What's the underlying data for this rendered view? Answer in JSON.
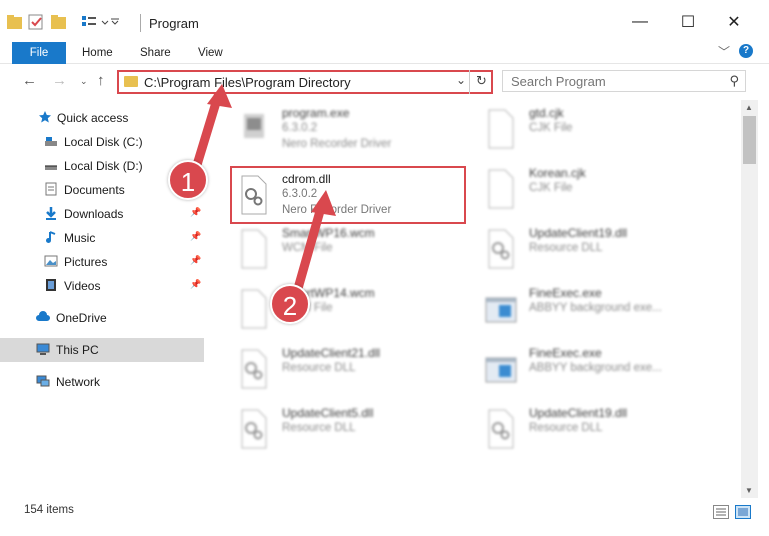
{
  "window": {
    "title": "Program",
    "minimize": "—",
    "maximize": "☐",
    "close": "✕"
  },
  "ribbon": {
    "tabs": [
      "File",
      "Home",
      "Share",
      "View"
    ],
    "help": "?"
  },
  "address": {
    "path": "C:\\Program Files\\Program Directory",
    "search_placeholder": "Search Program"
  },
  "sidebar": {
    "quick_access": "Quick access",
    "items": [
      {
        "label": "Local Disk (C:)",
        "icon": "drive-icon"
      },
      {
        "label": "Local Disk (D:)",
        "icon": "drive-icon"
      },
      {
        "label": "Documents",
        "icon": "documents-icon"
      },
      {
        "label": "Downloads",
        "icon": "downloads-icon"
      },
      {
        "label": "Music",
        "icon": "music-icon"
      },
      {
        "label": "Pictures",
        "icon": "pictures-icon"
      },
      {
        "label": "Videos",
        "icon": "videos-icon"
      }
    ],
    "onedrive": "OneDrive",
    "this_pc": "This PC",
    "network": "Network"
  },
  "files": [
    {
      "name": "program.exe",
      "line2": "6.3.0.2",
      "line3": "Nero Recorder Driver",
      "icon": "app-icon"
    },
    {
      "name": "gtd.cjk",
      "line2": "CJK File",
      "line3": "",
      "icon": "file-icon"
    },
    {
      "name": "cdrom.dll",
      "line2": "6.3.0.2",
      "line3": "Nero Recorder Driver",
      "icon": "dll-icon"
    },
    {
      "name": "Korean.cjk",
      "line2": "CJK File",
      "line3": "",
      "icon": "file-icon"
    },
    {
      "name": "SmartWP16.wcm",
      "line2": "WCM File",
      "line3": "",
      "icon": "file-icon"
    },
    {
      "name": "UpdateClient19.dll",
      "line2": "Resource DLL",
      "line3": "",
      "icon": "dll-icon"
    },
    {
      "name": "SmartWP14.wcm",
      "line2": "WCM File",
      "line3": "",
      "icon": "file-icon"
    },
    {
      "name": "FineExec.exe",
      "line2": "ABBYY background exe...",
      "line3": "",
      "icon": "app-window-icon"
    },
    {
      "name": "UpdateClient21.dll",
      "line2": "Resource DLL",
      "line3": "",
      "icon": "dll-icon"
    },
    {
      "name": "FineExec.exe",
      "line2": "ABBYY background exe...",
      "line3": "",
      "icon": "app-window-icon"
    },
    {
      "name": "UpdateClient5.dll",
      "line2": "Resource DLL",
      "line3": "",
      "icon": "dll-icon"
    },
    {
      "name": "UpdateClient19.dll",
      "line2": "Resource DLL",
      "line3": "",
      "icon": "dll-icon"
    }
  ],
  "status": {
    "items": "154 items"
  },
  "annotations": {
    "step1": "1",
    "step2": "2",
    "color": "#d9484e"
  }
}
